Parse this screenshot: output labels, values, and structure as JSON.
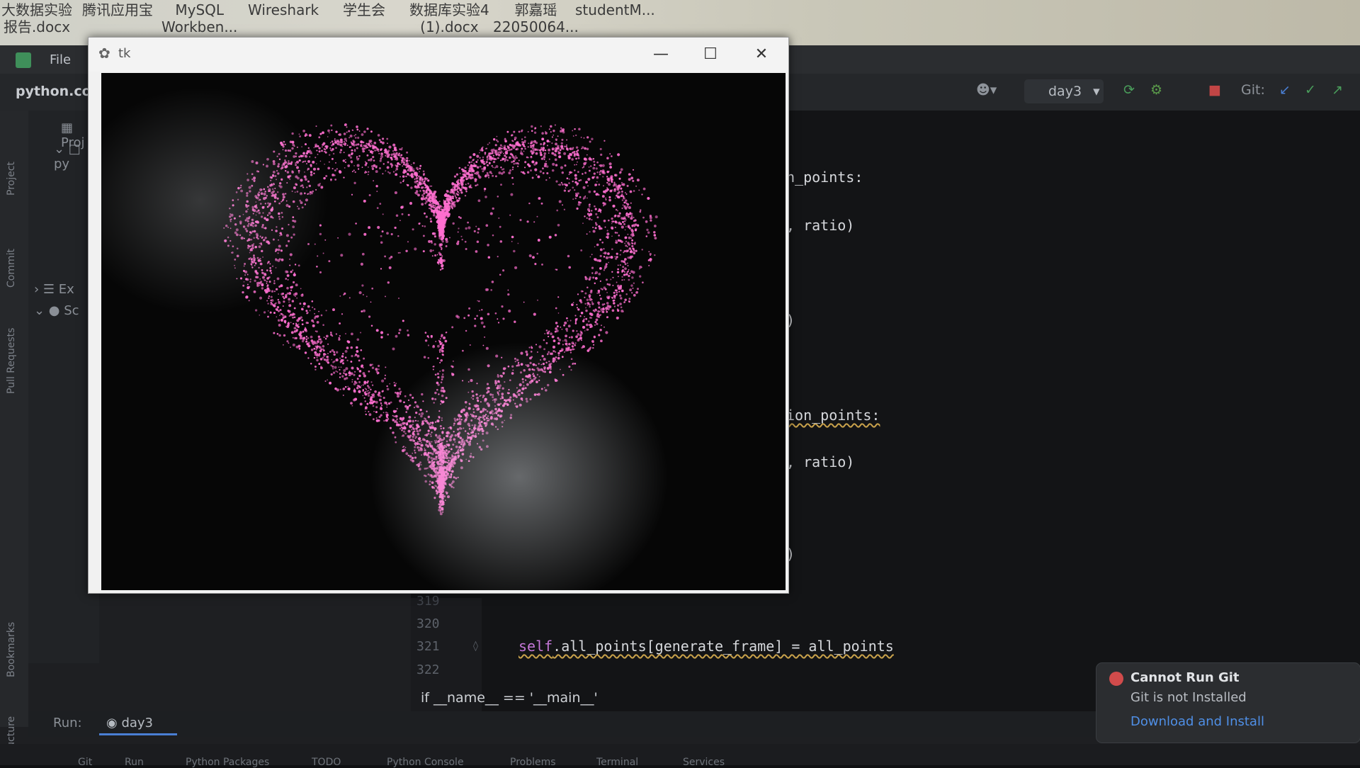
{
  "desktop": {
    "icons": [
      {
        "label": "大数据实验\n报告.docx"
      },
      {
        "label": "腾讯应用宝"
      },
      {
        "label": "MySQL\nWorkben..."
      },
      {
        "label": "Wireshark"
      },
      {
        "label": "学生会"
      },
      {
        "label": "数据库实验4\n(1).docx"
      },
      {
        "label": "郭嘉瑶\n22050064..."
      },
      {
        "label": "studentM..."
      }
    ]
  },
  "ide": {
    "menu_file": "File",
    "project_name": "python.coc",
    "branch": "day3",
    "git_label": "Git:",
    "tool_labels": [
      "Project",
      "Commit",
      "Pull Requests",
      "Bookmarks",
      "Structure"
    ],
    "tree": [
      {
        "label": "Proj"
      },
      {
        "label": "py"
      },
      {
        "label": "Ex"
      },
      {
        "label": "Sc"
      }
    ],
    "code_fragments": [
      {
        "text": "n_points:"
      },
      {
        "text": ", ratio)"
      },
      {
        "text": ")"
      },
      {
        "text": "ion_points:"
      },
      {
        "text": ", ratio)"
      },
      {
        "text": ")"
      }
    ],
    "line_numbers": [
      "319",
      "320",
      "321",
      "322"
    ],
    "code_line_self": "self",
    "code_line_rest": ".all_points[generate_frame] = all_points",
    "main_line": "if __name__ == '__main__'",
    "run_label": "Run:",
    "run_tab": "day3",
    "bottom_items": [
      "Git",
      "Run",
      "Python Packages",
      "TODO",
      "Python Console",
      "Problems",
      "Terminal",
      "Services"
    ]
  },
  "notification": {
    "title": "Cannot Run Git",
    "body": "Git is not Installed",
    "link": "Download and Install"
  },
  "tk_window": {
    "title": "tk",
    "minimize": "—",
    "maximize": "☐",
    "close": "✕",
    "heart_color": "#ff6fd0"
  },
  "colors": {
    "accent_link": "#4f8fe6",
    "error": "#d14b4b",
    "self_keyword": "#c577d8"
  }
}
